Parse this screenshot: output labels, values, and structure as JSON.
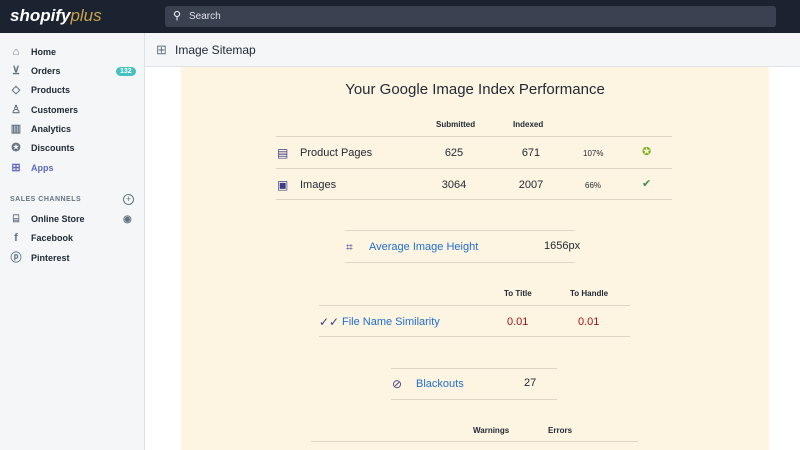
{
  "topbar": {
    "logo_main": "shopify",
    "logo_plus": "plus",
    "search_placeholder": "Search"
  },
  "sidebar": {
    "items": [
      {
        "label": "Home"
      },
      {
        "label": "Orders",
        "badge": "132"
      },
      {
        "label": "Products"
      },
      {
        "label": "Customers"
      },
      {
        "label": "Analytics"
      },
      {
        "label": "Discounts"
      },
      {
        "label": "Apps"
      }
    ],
    "section_title": "SALES CHANNELS",
    "channels": [
      {
        "label": "Online Store"
      },
      {
        "label": "Facebook"
      },
      {
        "label": "Pinterest"
      }
    ]
  },
  "header": {
    "title": "Image Sitemap"
  },
  "main": {
    "title": "Your Google Image Index Performance",
    "index_table": {
      "headers": [
        "Submitted",
        "Indexed"
      ],
      "rows": [
        {
          "label": "Product Pages",
          "submitted": "625",
          "indexed": "671",
          "percent": "107%",
          "status": "star"
        },
        {
          "label": "Images",
          "submitted": "3064",
          "indexed": "2007",
          "percent": "66%",
          "status": "check"
        }
      ]
    },
    "avg_height": {
      "label": "Average Image Height",
      "value": "1656px"
    },
    "similarity": {
      "headers": [
        "To Title",
        "To Handle"
      ],
      "label": "File Name Similarity",
      "to_title": "0.01",
      "to_handle": "0.01"
    },
    "blackouts": {
      "label": "Blackouts",
      "value": "27"
    },
    "issues": {
      "headers": [
        "Warnings",
        "Errors"
      ]
    }
  },
  "colors": {
    "accent": "#5c6ac4",
    "link": "#1f6fd0",
    "panel": "#fdf4e1",
    "red": "#a31616"
  }
}
